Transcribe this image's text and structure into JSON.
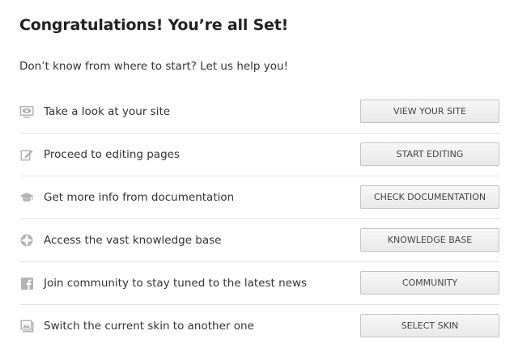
{
  "header": {
    "title": "Congratulations! You’re all Set!",
    "subtitle": "Don’t know from where to start? Let us help you!"
  },
  "colors": {
    "icon": "#b3b3b3",
    "divider": "#e1e1e1",
    "button_border": "#c4c4c4"
  },
  "actions": [
    {
      "icon": "eye-icon",
      "label": "Take a look at your site",
      "button": "VIEW YOUR SITE"
    },
    {
      "icon": "edit-icon",
      "label": "Proceed to editing pages",
      "button": "START EDITING"
    },
    {
      "icon": "graduation-cap-icon",
      "label": "Get more info from documentation",
      "button": "CHECK DOCUMENTATION"
    },
    {
      "icon": "lifebuoy-icon",
      "label": "Access the vast knowledge base",
      "button": "KNOWLEDGE BASE"
    },
    {
      "icon": "facebook-icon",
      "label": "Join community to stay tuned to the latest news",
      "button": "COMMUNITY"
    },
    {
      "icon": "picture-icon",
      "label": "Switch the current skin to another one",
      "button": "SELECT SKIN"
    }
  ]
}
